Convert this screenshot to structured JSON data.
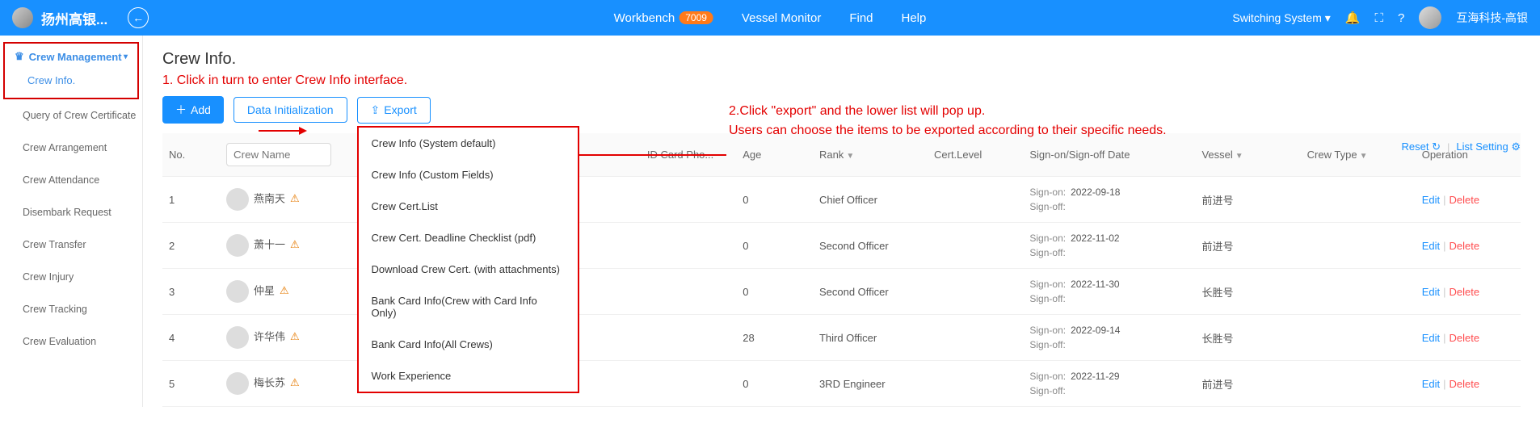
{
  "header": {
    "appName": "扬州高银...",
    "nav": {
      "workbench": "Workbench",
      "badge": "7009",
      "vesselMonitor": "Vessel Monitor",
      "find": "Find",
      "help": "Help"
    },
    "right": {
      "switch": "Switching System",
      "user": "互海科技-高银"
    }
  },
  "sidebar": {
    "head": "Crew Management",
    "sub": "Crew Info.",
    "items": [
      "Query of Crew Certificate",
      "Crew Arrangement",
      "Crew Attendance",
      "Disembark Request",
      "Crew Transfer",
      "Crew Injury",
      "Crew Tracking",
      "Crew Evaluation"
    ]
  },
  "page": {
    "title": "Crew Info."
  },
  "annot": {
    "a1": "1. Click in turn to enter Crew Info interface.",
    "a2a": "2.Click \"export\" and the lower list will pop up.",
    "a2b": "Users can choose the items to be exported according to their specific needs."
  },
  "toolbar": {
    "add": "Add",
    "init": "Data Initialization",
    "export": "Export"
  },
  "exportMenu": [
    "Crew Info (System default)",
    "Crew Info (Custom Fields)",
    "Crew Cert.List",
    "Crew Cert. Deadline Checklist (pdf)",
    "Download Crew Cert. (with attachments)",
    "Bank Card Info(Crew with Card Info Only)",
    "Bank Card Info(All Crews)",
    "Work Experience"
  ],
  "rightLinks": {
    "reset": "Reset",
    "listSetting": "List Setting"
  },
  "columns": {
    "no": "No.",
    "crewName": "Crew Name",
    "idcard": "ID Card Pho...",
    "age": "Age",
    "rank": "Rank",
    "certLevel": "Cert.Level",
    "signDate": "Sign-on/Sign-off Date",
    "vessel": "Vessel",
    "crewType": "Crew Type",
    "op": "Operation"
  },
  "signLabel": {
    "on": "Sign-on:",
    "off": "Sign-off:"
  },
  "op": {
    "edit": "Edit",
    "del": "Delete"
  },
  "rows": [
    {
      "no": "1",
      "name": "燕南天",
      "age": "0",
      "rank": "Chief Officer",
      "date": "2022-09-18",
      "vessel": "前进号"
    },
    {
      "no": "2",
      "name": "萧十一",
      "age": "0",
      "rank": "Second Officer",
      "date": "2022-11-02",
      "vessel": "前进号"
    },
    {
      "no": "3",
      "name": "仲星",
      "age": "0",
      "rank": "Second Officer",
      "date": "2022-11-30",
      "vessel": "长胜号"
    },
    {
      "no": "4",
      "name": "许华伟",
      "age": "28",
      "rank": "Third Officer",
      "date": "2022-09-14",
      "vessel": "长胜号"
    },
    {
      "no": "5",
      "name": "梅长苏",
      "age": "0",
      "rank": "3RD Engineer",
      "date": "2022-11-29",
      "vessel": "前进号"
    }
  ]
}
